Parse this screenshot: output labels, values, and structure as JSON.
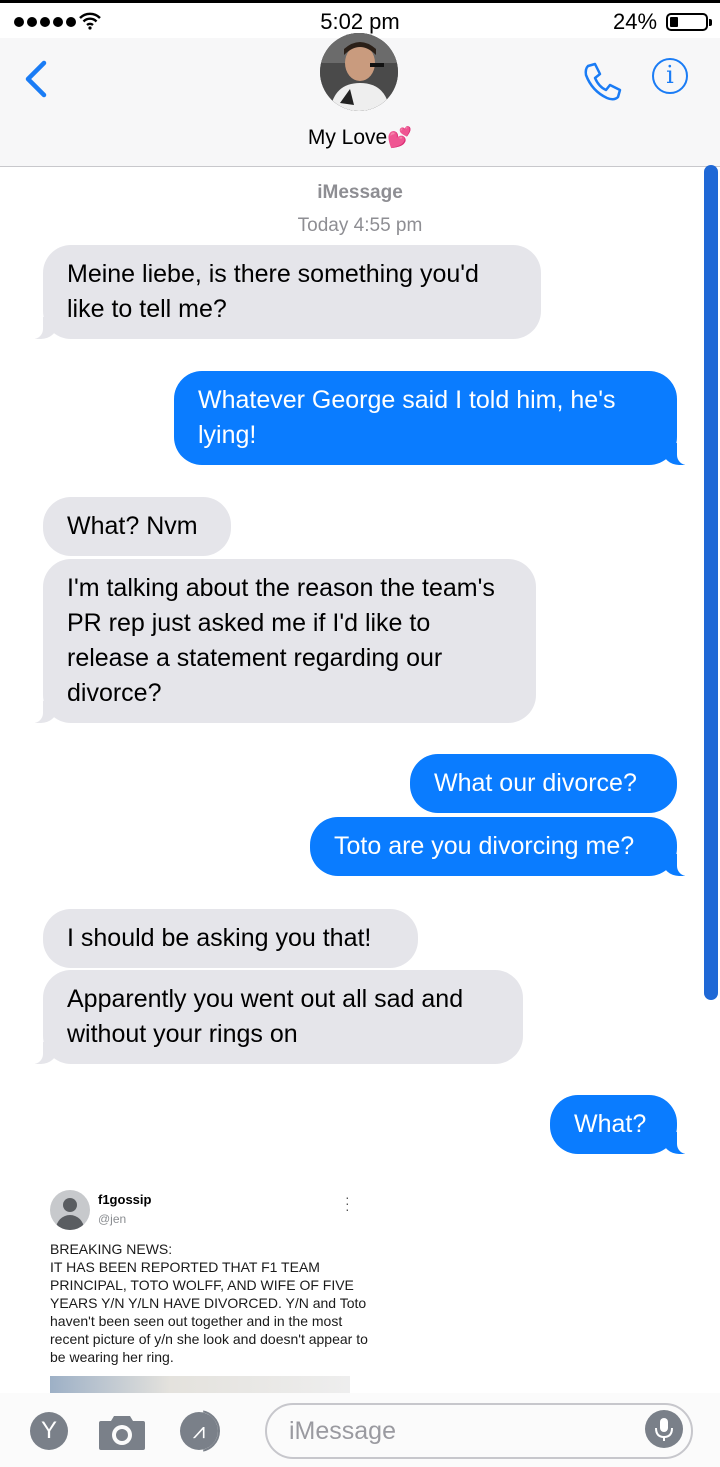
{
  "status_bar": {
    "time": "5:02 pm",
    "battery": "24%"
  },
  "header": {
    "contact_name": "My Love",
    "contact_emoji": "💕"
  },
  "thread": {
    "service": "iMessage",
    "timestamp": "Today 4:55 pm",
    "messages": [
      {
        "from": "them",
        "text": "Meine liebe, is there something you'd like to tell me?"
      },
      {
        "from": "me",
        "text": "Whatever George said I told him, he's lying!"
      },
      {
        "from": "them",
        "text": "What? Nvm"
      },
      {
        "from": "them",
        "text": "I'm talking about the reason the team's PR rep just asked me if I'd like to release a statement regarding our divorce?"
      },
      {
        "from": "me",
        "text": "What our divorce?"
      },
      {
        "from": "me",
        "text": "Toto are you divorcing me?"
      },
      {
        "from": "them",
        "text": "I should be asking you that!"
      },
      {
        "from": "them",
        "text": "Apparently you went out all sad and without your rings on"
      },
      {
        "from": "me",
        "text": "What?"
      }
    ]
  },
  "tweet": {
    "name": "f1gossip",
    "handle": "@jen",
    "body": "BREAKING NEWS:\nIT HAS BEEN REPORTED THAT F1 TEAM PRINCIPAL, TOTO WOLFF, AND WIFE OF FIVE YEARS Y/N Y/LN HAVE DIVORCED. Y/N and Toto haven't been seen out together and in the most recent picture of y/n she look and doesn't appear to be wearing her ring."
  },
  "input_bar": {
    "placeholder": "iMessage",
    "avatar_letter": "Y"
  },
  "colors": {
    "accent": "#0a7cff",
    "incoming": "#e5e5ea",
    "icon_blue": "#1a7cf5"
  }
}
